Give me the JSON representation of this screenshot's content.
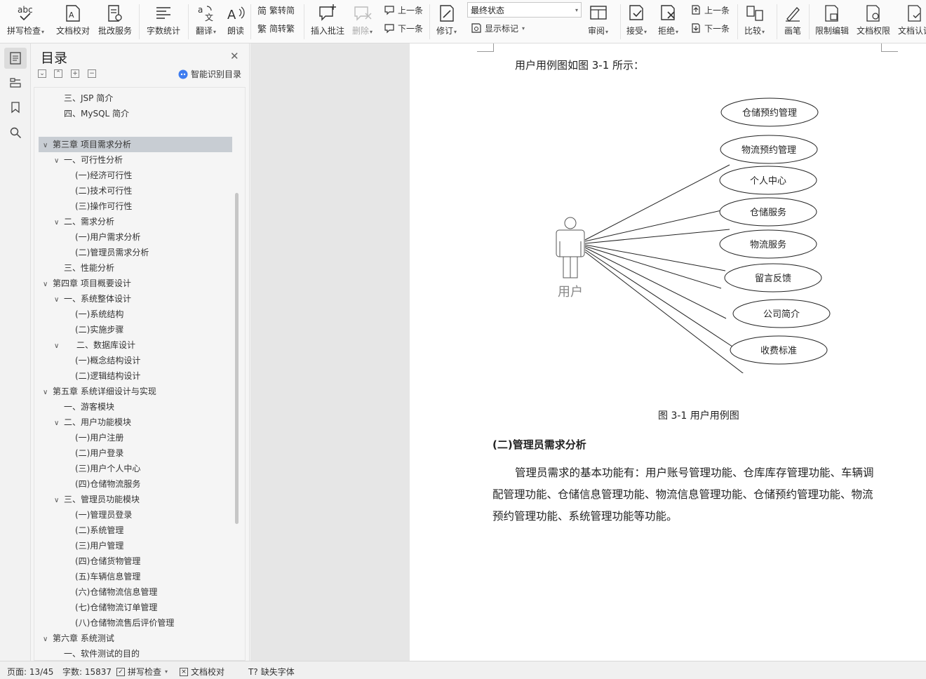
{
  "ribbon": {
    "spell_check": "拼写检查",
    "doc_proof": "文档校对",
    "batch_service": "批改服务",
    "word_count": "字数统计",
    "translate": "翻译",
    "read_aloud": "朗读",
    "trad_to_simp": "繁转简",
    "simp_to_trad": "简转繁",
    "insert_comment": "插入批注",
    "delete": "删除",
    "prev_comment": "上一条",
    "next_comment": "下一条",
    "track_changes": "修订",
    "view_state": "最终状态",
    "show_markup": "显示标记",
    "review": "审阅",
    "accept": "接受",
    "reject": "拒绝",
    "prev_change": "上一条",
    "next_change": "下一条",
    "compare": "比较",
    "ink": "画笔",
    "restrict_edit": "限制编辑",
    "doc_permission": "文档权限",
    "doc_cert": "文档认证",
    "abc_icon_text": "abc"
  },
  "nav": {
    "title": "目录",
    "smart_toc": "智能识别目录",
    "items": [
      {
        "text": "三、JSP 简介"
      },
      {
        "text": "四、MySQL 简介"
      },
      {
        "text": "第三章  项目需求分析"
      },
      {
        "text": "一、可行性分析"
      },
      {
        "text": "(一)经济可行性"
      },
      {
        "text": "(二)技术可行性"
      },
      {
        "text": "(三)操作可行性"
      },
      {
        "text": "二、需求分析"
      },
      {
        "text": "(一)用户需求分析"
      },
      {
        "text": "(二)管理员需求分析"
      },
      {
        "text": "三、性能分析"
      },
      {
        "text": "第四章  项目概要设计"
      },
      {
        "text": "一、系统整体设计"
      },
      {
        "text": "(一)系统结构"
      },
      {
        "text": "(二)实施步骤"
      },
      {
        "text": "二、数据库设计"
      },
      {
        "text": "(一)概念结构设计"
      },
      {
        "text": "(二)逻辑结构设计"
      },
      {
        "text": "第五章  系统详细设计与实现"
      },
      {
        "text": "一、游客模块"
      },
      {
        "text": "二、用户功能模块"
      },
      {
        "text": "(一)用户注册"
      },
      {
        "text": "(二)用户登录"
      },
      {
        "text": "(三)用户个人中心"
      },
      {
        "text": "(四)仓储物流服务"
      },
      {
        "text": "三、管理员功能模块"
      },
      {
        "text": "(一)管理员登录"
      },
      {
        "text": "(二)系统管理"
      },
      {
        "text": "(三)用户管理"
      },
      {
        "text": "(四)仓储货物管理"
      },
      {
        "text": "(五)车辆信息管理"
      },
      {
        "text": "(六)仓储物流信息管理"
      },
      {
        "text": "(七)仓储物流订单管理"
      },
      {
        "text": "(八)仓储物流售后评价管理"
      },
      {
        "text": "第六章  系统测试"
      },
      {
        "text": "一、软件测试的目的"
      }
    ]
  },
  "document": {
    "intro": "用户用例图如图 3-1 所示：",
    "actor": "用户",
    "use_cases": [
      "仓储预约管理",
      "物流预约管理",
      "个人中心",
      "仓储服务",
      "物流服务",
      "留言反馈",
      "公司简介",
      "收费标准"
    ],
    "figure_caption": "图 3-1 用户用例图",
    "section_heading": "(二)管理员需求分析",
    "para_lines": [
      "管理员需求的基本功能有：用户账号管理功能、仓库库存管理功能、车辆调",
      "配管理功能、仓储信息管理功能、物流信息管理功能、仓储预约管理功能、物流",
      "预约管理功能、系统管理功能等功能。"
    ]
  },
  "status_bar": {
    "page": "页面: 13/45",
    "word_count": "字数: 15837",
    "spell_check": "拼写检查",
    "doc_proof": "文档校对",
    "missing_font": "缺失字体"
  }
}
